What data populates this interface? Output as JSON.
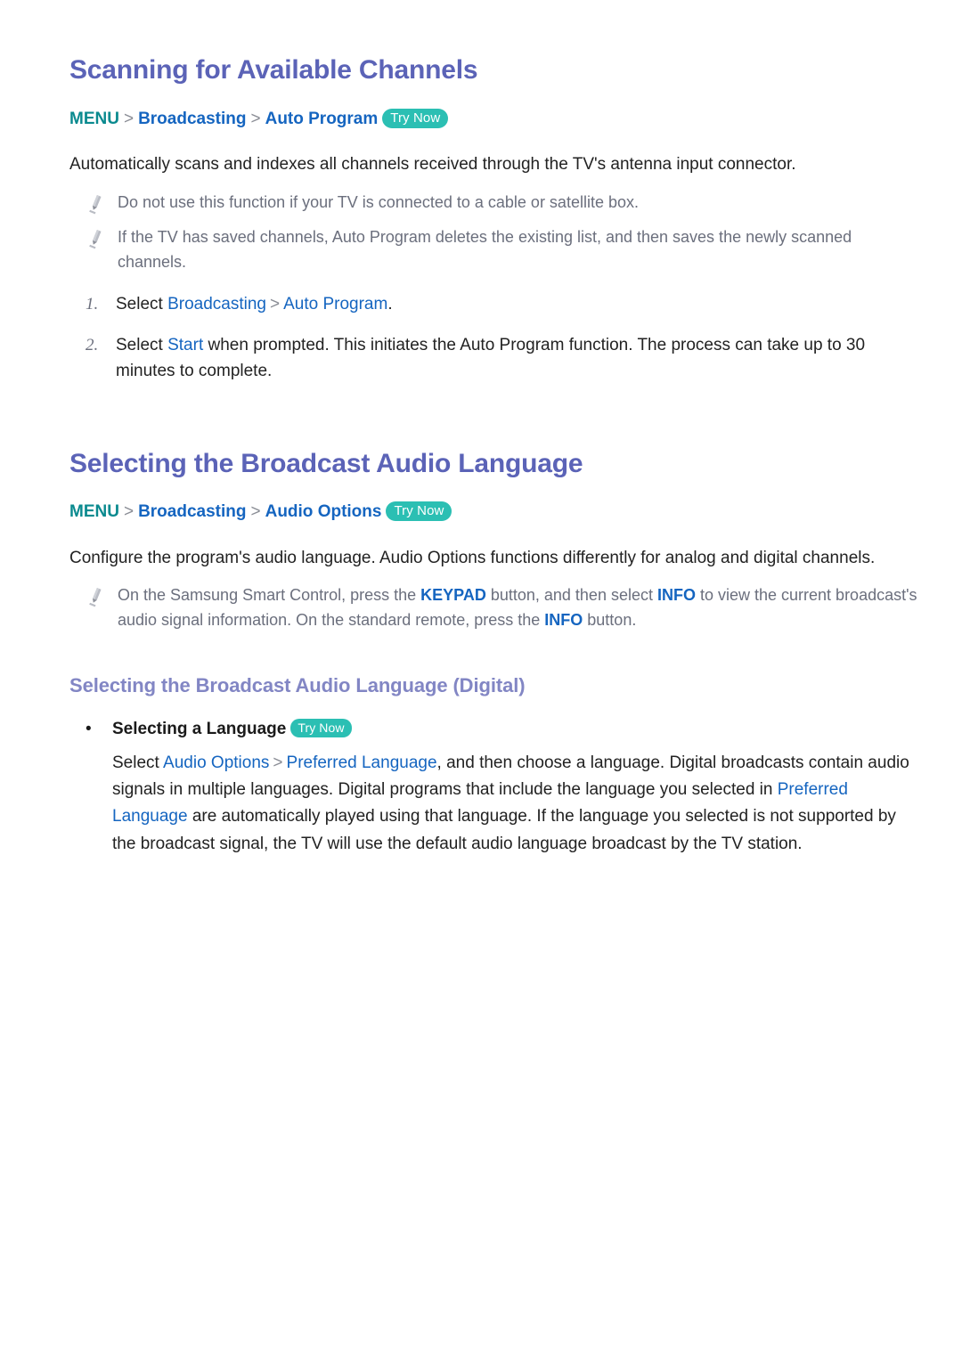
{
  "document": {
    "title": "Samsung TV e-Manual page — Channel scanning and audio language"
  },
  "sections": [
    {
      "id": "scanning",
      "heading": "Scanning for Available Channels",
      "menu_path": {
        "root": "MENU",
        "separator": ">",
        "items": [
          "Broadcasting",
          "Auto Program"
        ],
        "badge": "Try Now"
      },
      "intro": "Automatically scans and indexes all channels received through the TV's antenna input connector.",
      "notes": [
        "Do not use this function if your TV is connected to a cable or satellite box.",
        "If the TV has saved channels, Auto Program deletes the existing list, and then saves the newly scanned channels."
      ],
      "steps": [
        {
          "number": "1.",
          "prefix": "Select ",
          "link1": "Broadcasting",
          "separator": ">",
          "link2": "Auto Program",
          "suffix": "."
        },
        {
          "number": "2.",
          "prefix": "Select ",
          "link1": "Start",
          "suffix": " when prompted. This initiates the Auto Program function. The process can take up to 30 minutes to complete."
        }
      ]
    },
    {
      "id": "audio-language",
      "heading": "Selecting the Broadcast Audio Language",
      "menu_path": {
        "root": "MENU",
        "separator": ">",
        "items": [
          "Broadcasting",
          "Audio Options"
        ],
        "badge": "Try Now"
      },
      "intro": "Configure the program's audio language. Audio Options functions differently for analog and digital channels.",
      "note_rich": {
        "part1": "On the Samsung Smart Control, press the ",
        "key1": "KEYPAD",
        "part2": " button, and then select ",
        "key2": "INFO",
        "part3": " to view the current broadcast's audio signal information. On the standard remote, press the ",
        "key3": "INFO",
        "part4": " button."
      },
      "subsection": {
        "heading": "Selecting the Broadcast Audio Language (Digital)",
        "bullet": {
          "marker": "•",
          "label": "Selecting a Language",
          "badge": "Try Now"
        },
        "body": {
          "part1": "Select ",
          "link1": "Audio Options",
          "separator": ">",
          "link2": "Preferred Language",
          "part2": ", and then choose a language. Digital broadcasts contain audio signals in multiple languages. Digital programs that include the language you selected in ",
          "link3": "Preferred Language",
          "part3": " are automatically played using that language. If the language you selected is not supported by the broadcast signal, the TV will use the default audio language broadcast by the TV station."
        }
      }
    }
  ],
  "icons": {
    "note": "pencil-icon"
  },
  "colors": {
    "heading": "#5b63b7",
    "subheading": "#8286c4",
    "menu_root": "#0a8a8f",
    "link": "#1565c0",
    "badge_bg": "#2bbfb3",
    "note_text": "#6b6f7d",
    "body_text": "#222222"
  }
}
